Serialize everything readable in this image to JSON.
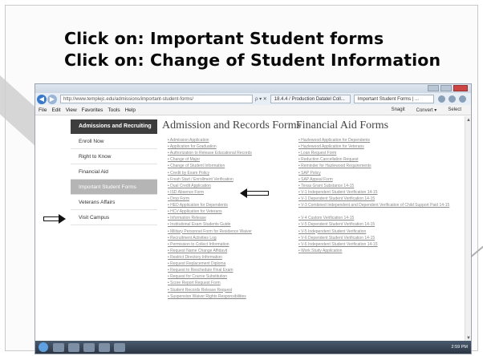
{
  "slide": {
    "headline_1": "Click on: Important Student forms",
    "headline_2": "Click on: Change of Student Information"
  },
  "browser": {
    "url": "http://www.templejc.edu/admissions/important-student-forms/",
    "url_controls": "ρ ▾ ✕",
    "tab_1": "18.4.4 / Production Datatel Coll...",
    "tab_2": "Important Student Forms | ...",
    "menu": [
      "File",
      "Edit",
      "View",
      "Favorites",
      "Tools",
      "Help"
    ],
    "tools": [
      "Snagit",
      "Convert ▾",
      "Select"
    ],
    "taskbar_clock": "2:59 PM"
  },
  "sidebar": {
    "header": "Admissions and Recruiting",
    "items": [
      {
        "label": "Enroll Now",
        "active": false
      },
      {
        "label": "Right to Know",
        "active": false
      },
      {
        "label": "Financial Aid",
        "active": false
      },
      {
        "label": "Important Student Forms",
        "active": true
      },
      {
        "label": "Veterans Affairs",
        "active": false
      },
      {
        "label": "Visit Campus",
        "active": false
      }
    ]
  },
  "admission_forms": {
    "title": "Admission and Records Forms",
    "links": [
      "Admission Application",
      "Application for Graduation",
      "Authorization to Release Educational Records",
      "Change of Major",
      "Change of Student Information",
      "Credit by Exam Policy",
      "Fresh Start / Enrollment Verification",
      "Dual Credit Application",
      "ISD Absence Form",
      "Drop Form",
      "HED Application for Dependents",
      "HCV Application for Veterans",
      "Information Release",
      "Institutional Exam Students Guide",
      "Military Personnel Form for Residence Waiver",
      "Recruitment Activities Log",
      "Permission to Collect Information",
      "Request Name Change Affidavit",
      "Restrict Directory Information",
      "Request Replacement Diploma",
      "Request to Reschedule Final Exam",
      "Request for Course Substitution",
      "Score Report Request Form",
      "Student Records Release Request",
      "Suspension Waiver Rights Responsibilities"
    ]
  },
  "financial_forms": {
    "title": "Financial Aid Forms",
    "links": [
      "Hazlewood Application for Dependents",
      "Hazlewood Application for Veterans",
      "Loan Request Form",
      "Reduction Cancellation Request",
      "Reminder for Hazlewood Requirements",
      "SAP Policy",
      "SAP Appeal Form",
      "Texas Grant Substance 14-15",
      "V-1 Independent Student Verification 14-15",
      "V-1 Dependent Student Verification 14-15",
      "V-3 Combined Independent and Dependent Verification of Child Support Paid 14-15",
      "",
      "V-4 Custom Verification 14-15",
      "V-5 Dependent Student Verification 14-15",
      "V-5 Independent Student Verification",
      "V-6 Dependent Student Verification 14-15",
      "V-6 Independent Student Verification 14-15",
      "Work Study Application"
    ]
  },
  "icons": {
    "arrow_sidebar": "right-arrow-icon",
    "arrow_link": "left-arrow-icon"
  }
}
